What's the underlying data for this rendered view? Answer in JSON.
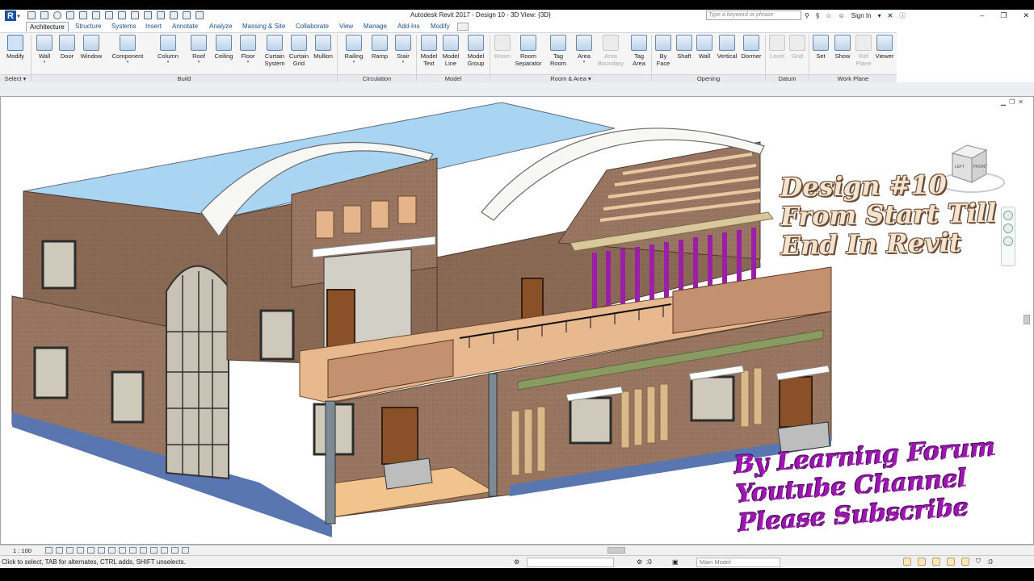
{
  "app": {
    "logo_letter": "R",
    "title": "Autodesk Revit 2017 -    Design 10 - 3D View: {3D}"
  },
  "search": {
    "placeholder": "Type a keyword or phrase"
  },
  "account": {
    "sign_in": "Sign In"
  },
  "tabs": [
    {
      "label": "Architecture",
      "active": true
    },
    {
      "label": "Structure"
    },
    {
      "label": "Systems"
    },
    {
      "label": "Insert"
    },
    {
      "label": "Annotate"
    },
    {
      "label": "Analyze"
    },
    {
      "label": "Massing & Site"
    },
    {
      "label": "Collaborate"
    },
    {
      "label": "View"
    },
    {
      "label": "Manage"
    },
    {
      "label": "Add-Ins"
    },
    {
      "label": "Modify"
    }
  ],
  "ribbon": {
    "select": {
      "modify": "Modify",
      "label": "Select"
    },
    "build": {
      "label": "Build",
      "tools": [
        "Wall",
        "Door",
        "Window",
        "Component",
        "Column",
        "Roof",
        "Ceiling",
        "Floor"
      ],
      "curtain_system": [
        "Curtain",
        "System"
      ],
      "curtain_grid": [
        "Curtain",
        "Grid"
      ],
      "mullion": "Mullion"
    },
    "circulation": {
      "label": "Circulation",
      "tools": [
        "Railing",
        "Ramp",
        "Stair"
      ]
    },
    "model": {
      "label": "Model",
      "model_text": [
        "Model",
        "Text"
      ],
      "model_line": [
        "Model",
        "Line"
      ],
      "model_group": [
        "Model",
        "Group"
      ]
    },
    "room_area": {
      "label": "Room & Area",
      "room": "Room",
      "room_separator": [
        "Room",
        "Separator"
      ],
      "tag_room": [
        "Tag",
        "Room"
      ],
      "area": "Area",
      "area_boundary": [
        "Area",
        "Boundary"
      ],
      "tag_area": [
        "Tag",
        "Area"
      ]
    },
    "opening": {
      "label": "Opening",
      "by_face": [
        "By",
        "Face"
      ],
      "tools": [
        "Shaft",
        "Wall",
        "Vertical",
        "Dormer"
      ]
    },
    "datum": {
      "label": "Datum",
      "tools": [
        "Level",
        "Grid"
      ]
    },
    "work_plane": {
      "label": "Work Plane",
      "set": "Set",
      "show": "Show",
      "ref_plane": [
        "Ref",
        "Plane"
      ],
      "viewer": "Viewer"
    }
  },
  "overlay": {
    "design_lines": [
      "Design #10",
      "From Start Till",
      "End In Revit"
    ],
    "channel_lines": [
      "By Learning Forum",
      "Youtube Channel",
      "Please Subscribe"
    ]
  },
  "viewcube": {
    "left": "LEFT",
    "front": "FRONT"
  },
  "viewbar": {
    "scale": "1 : 100"
  },
  "status": {
    "message": "Click to select, TAB for alternates, CTRL adds, SHIFT unselects.",
    "count_a": ":0",
    "model": "Main Model",
    "count_b": ":0"
  }
}
